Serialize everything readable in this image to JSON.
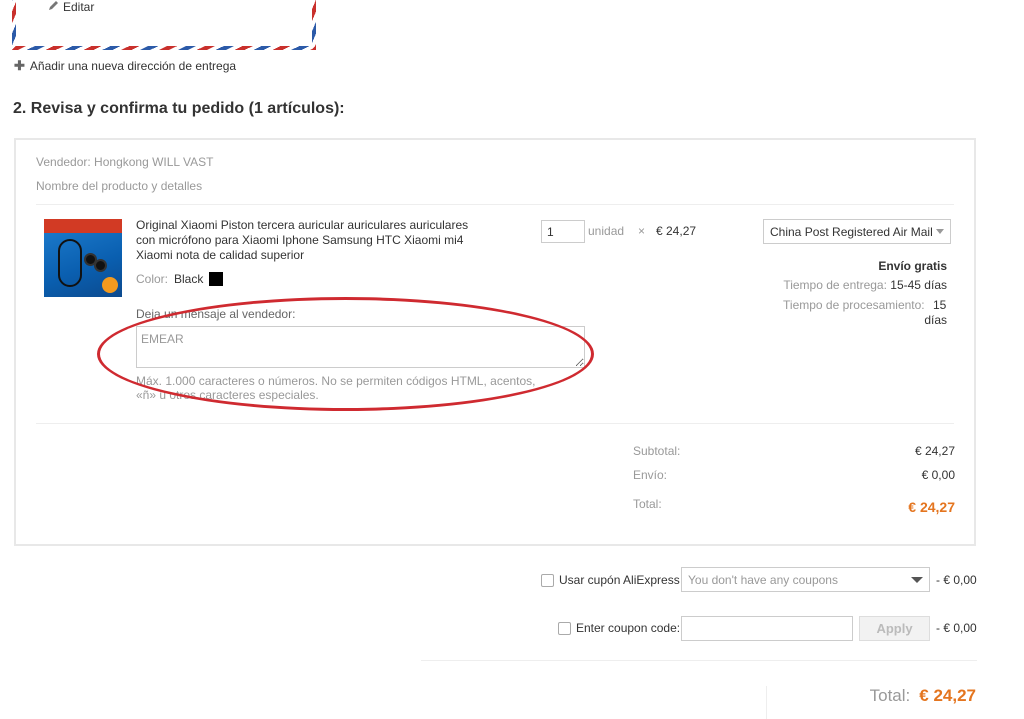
{
  "address": {
    "edit_label": "Editar",
    "add_address_label": "Añadir una nueva dirección de entrega"
  },
  "section": {
    "title": "2. Revisa y confirma tu pedido (1 artículos):"
  },
  "order": {
    "seller": "Vendedor: Hongkong WILL VAST",
    "details_header": "Nombre del producto y detalles",
    "product": {
      "name": "Original Xiaomi Piston tercera auricular auriculares auriculares con micrófono para Xiaomi Iphone Samsung HTC Xiaomi mi4 Xiaomi nota de calidad superior",
      "color_label": "Color:",
      "color_value": "Black",
      "color_hex": "#000000",
      "quantity": "1",
      "unit_label": "unidad",
      "times": "×",
      "unit_price": "€ 24,27"
    },
    "message": {
      "label": "Deja un mensaje al vendedor:",
      "value": "EMEAR",
      "note": "Máx. 1.000 caracteres o números. No se permiten códigos HTML, acentos, «ñ» u otros caracteres especiales."
    },
    "shipping": {
      "method": "China Post Registered Air Mail",
      "free_label": "Envío gratis",
      "delivery_label": "Tiempo de entrega:",
      "delivery_value": "15-45 días",
      "processing_label": "Tiempo de procesamiento:",
      "processing_value_1": "15",
      "processing_value_2": "días"
    },
    "summary": {
      "subtotal_label": "Subtotal:",
      "subtotal_value": "€ 24,27",
      "shipping_label": "Envío:",
      "shipping_value": "€ 0,00",
      "total_label": "Total:",
      "total_value": "€ 24,27"
    }
  },
  "coupons": {
    "aliexpress_label": "Usar cupón AliExpress",
    "aliexpress_placeholder": "You don't have any coupons",
    "aliexpress_discount": "- € 0,00",
    "code_label": "Enter coupon code:",
    "code_value": "",
    "apply_label": "Apply",
    "code_discount": "- € 0,00"
  },
  "grand_total": {
    "label": "Total:",
    "value": "€ 24,27"
  },
  "colors": {
    "accent": "#e4751f",
    "annotation": "#cf2a30"
  }
}
